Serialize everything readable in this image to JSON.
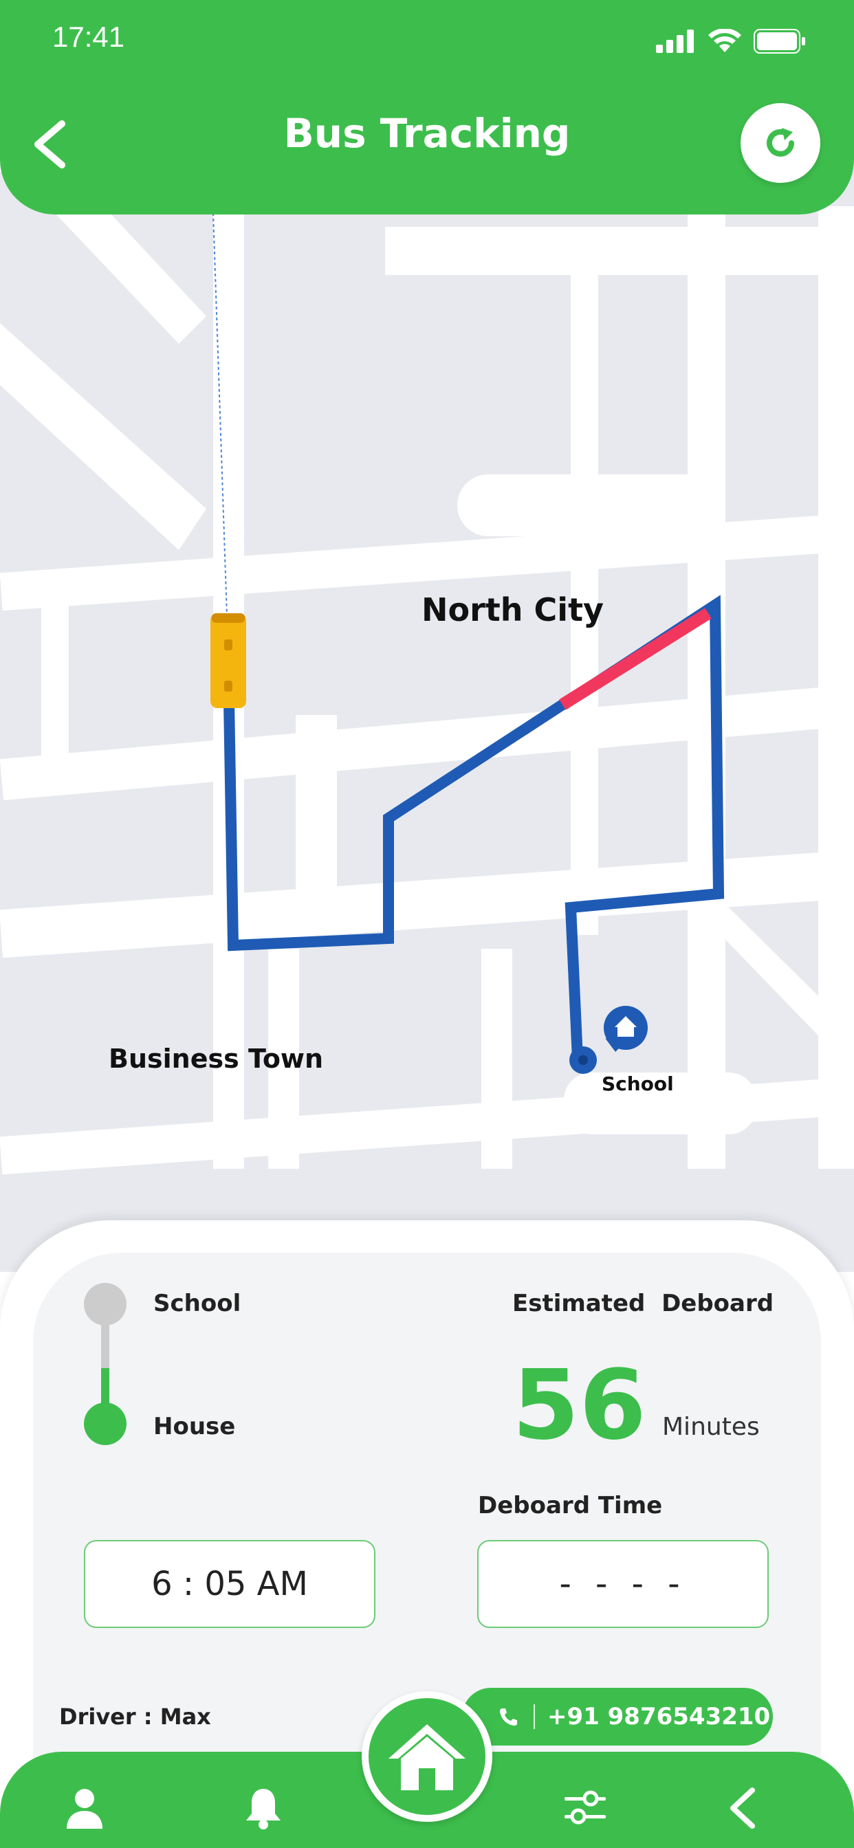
{
  "status_bar": {
    "time": "17:41"
  },
  "header": {
    "title": "Bus Tracking"
  },
  "map": {
    "labels": {
      "north_city": "North City",
      "business_town": "Business Town",
      "school": "School"
    },
    "colors": {
      "route": "#1F5BB5",
      "delay_segment": "#F2375E",
      "roads": "#FFFFFF",
      "blocks": "#E7E9EE"
    }
  },
  "trip": {
    "from": "School",
    "to": "House",
    "estimated_label": "Estimated  Deboard",
    "minutes_value": "56",
    "minutes_unit": "Minutes",
    "deboard_time_label": "Deboard Time",
    "start_time": "6 : 05 AM",
    "deboard_time": "- - - -",
    "driver": "Driver : Max",
    "phone": "+91 9876543210"
  },
  "nav": {
    "items": [
      "profile-icon",
      "bell-icon",
      "home-icon",
      "filter-icon",
      "back-icon"
    ]
  },
  "colors": {
    "accent": "#3DBE4C"
  }
}
